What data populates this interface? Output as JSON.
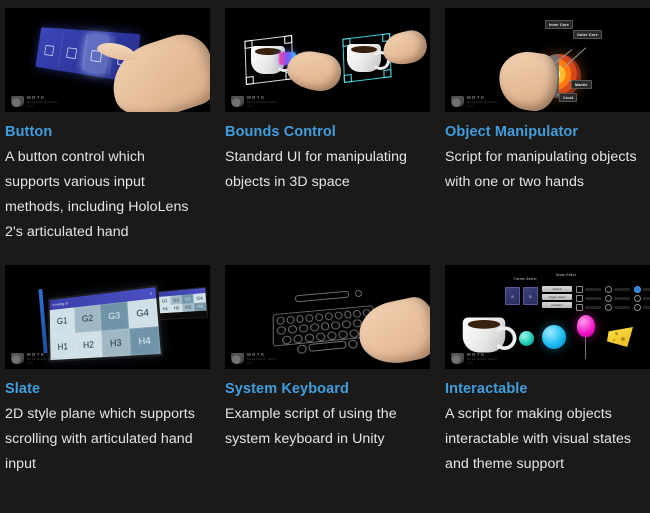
{
  "page": {
    "background_color": "#1b1a19",
    "title_color": "#3f9ede",
    "body_text_color": "#e6e4e2"
  },
  "cards": [
    {
      "title": "Button",
      "description": "A button control which supports various input methods, including HoloLens 2's articulated hand",
      "thumbnail": {
        "alt": "Hand pressing a blue holographic button panel",
        "watermark": {
          "line1": "MRTK",
          "line2": "Mixed Reality Toolkit",
          "line3": "v2.5"
        }
      }
    },
    {
      "title": "Bounds Control",
      "description": "Standard UI for manipulating objects in 3D space",
      "thumbnail": {
        "alt": "Two coffee mugs inside bounding boxes being manipulated by hands",
        "watermark": {
          "line1": "MRTK",
          "line2": "Mixed Reality Toolkit",
          "line3": "v2.5"
        }
      }
    },
    {
      "title": "Object Manipulator",
      "description": "Script for manipulating objects with one or two hands",
      "thumbnail": {
        "alt": "Hand holding a cutaway Earth globe with labeled layers",
        "labels": [
          "Inner Core",
          "Outer Core",
          "Mantle",
          "Crust"
        ],
        "watermark": {
          "line1": "MRTK",
          "line2": "Mixed Reality Toolkit",
          "line3": "v2.5"
        }
      }
    },
    {
      "title": "Slate",
      "description": "2D style plane which supports scrolling with articulated hand input",
      "thumbnail": {
        "alt": "Holographic 2D slate panel showing a scrollable grid",
        "window_title": "Scrolling UI",
        "grid_cells": [
          "G1",
          "G2",
          "G3",
          "G4",
          "H1",
          "H2",
          "H3",
          "H4"
        ],
        "watermark": {
          "line1": "MRTK",
          "line2": "Mixed Reality Toolkit",
          "line3": "v2.5"
        }
      }
    },
    {
      "title": "System Keyboard",
      "description": "Example script of using the system keyboard in Unity",
      "thumbnail": {
        "alt": "Hand typing on a wireframe holographic keyboard",
        "watermark": {
          "line1": "MRTK",
          "line2": "Mixed Reality Toolkit",
          "line3": "v2.5"
        }
      }
    },
    {
      "title": "Interactable",
      "description": "A script for making objects interactable with visual states and theme support",
      "thumbnail": {
        "alt": "Coffee mug, spheres, balloon and cheese wedge with a states panel",
        "panel_headings": [
          "Theme Select",
          "State Effect"
        ],
        "watermark": {
          "line1": "MRTK",
          "line2": "Mixed Reality Toolkit",
          "line3": "v2.5"
        }
      }
    }
  ]
}
